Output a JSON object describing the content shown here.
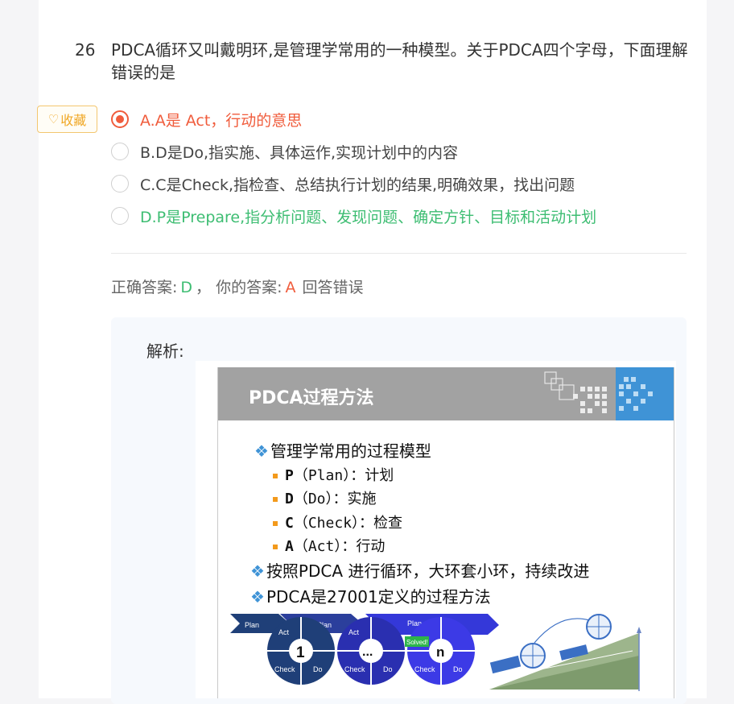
{
  "question": {
    "number": "26",
    "text": "PDCA循环又叫戴明环,是管理学常用的一种模型。关于PDCA四个字母，下面理解错误的是"
  },
  "favorite": {
    "icon": "heart-outline-icon",
    "label": "收藏"
  },
  "options": [
    {
      "text": "A.A是 Act，行动的意思",
      "state": "selected-wrong"
    },
    {
      "text": "B.D是Do,指实施、具体运作,实现计划中的内容",
      "state": "normal"
    },
    {
      "text": "C.C是Check,指检查、总结执行计划的结果,明确效果，找出问题",
      "state": "normal"
    },
    {
      "text": "D.P是Prepare,指分析问题、发现问题、确定方针、目标和活动计划",
      "state": "correct"
    }
  ],
  "result": {
    "correct_label": "正确答案:",
    "correct_value": "D",
    "separator": "，",
    "yours_label": "你的答案:",
    "yours_value": "A",
    "status": "回答错误"
  },
  "analysis": {
    "label": "解析:",
    "slide": {
      "title": "PDCA过程方法",
      "bullet1": "管理学常用的过程模型",
      "subs": [
        {
          "letter": "P",
          "rest": "（Plan）：计划"
        },
        {
          "letter": "D",
          "rest": "（Do）：实施"
        },
        {
          "letter": "C",
          "rest": "（Check）：检查"
        },
        {
          "letter": "A",
          "rest": "（Act）：行动"
        }
      ],
      "bullet2": "按照PDCA 进行循环，大环套小环，持续改进",
      "bullet3": "PDCA是27001定义的过程方法",
      "diagram": {
        "plan": "Plan",
        "act": "Act",
        "do": "Do",
        "check": "Check",
        "cycle_1": "1",
        "cycle_dots": "...",
        "cycle_n": "n",
        "solved": "Solved!"
      }
    }
  },
  "colors": {
    "wrong": "#f05c3c",
    "correct": "#3dbd72",
    "favorite": "#f0a826",
    "slide_header": "#a2a2a2",
    "slide_accent": "#3f93d6"
  }
}
